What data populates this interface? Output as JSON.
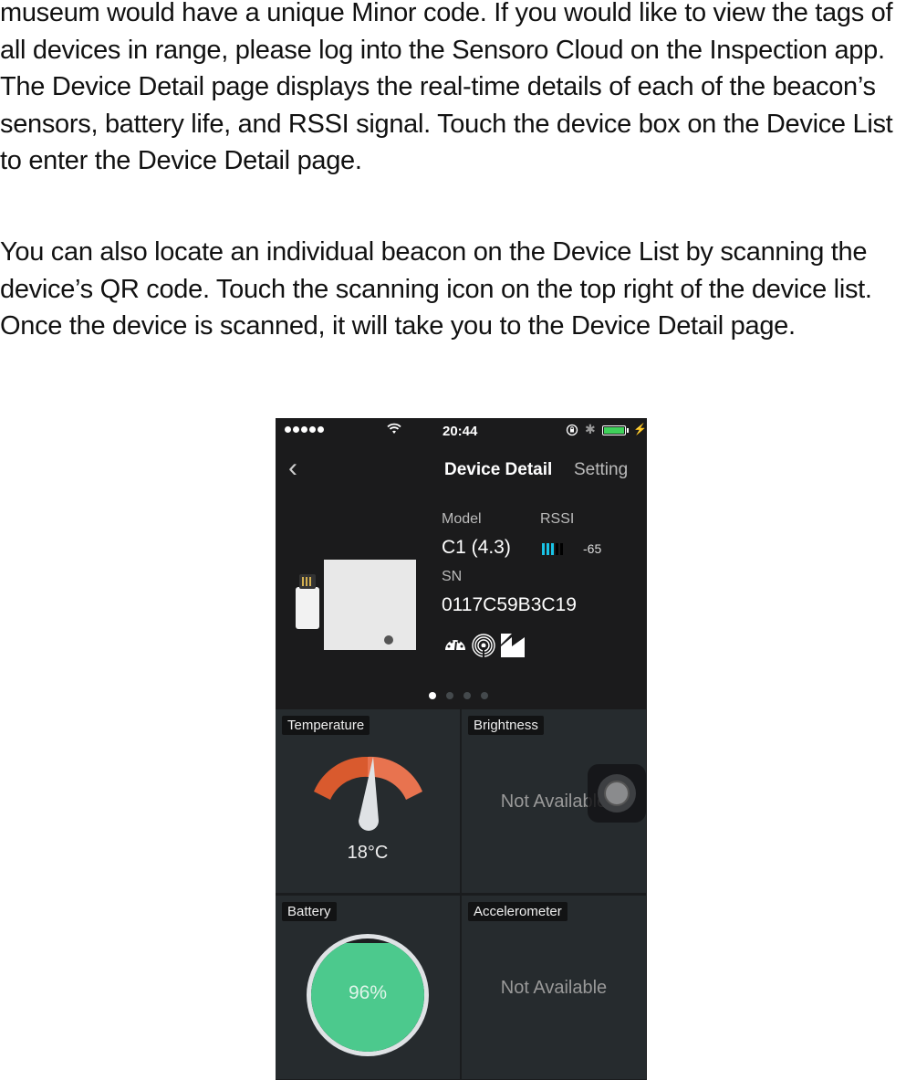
{
  "document": {
    "paragraph1": "museum would have a unique Minor code. If you would like to view the tags of all devices in range, please log into the Sensoro Cloud on the Inspection app.",
    "paragraph1b": "The Device Detail page displays the real-time details of each of the beacon’s sensors, battery life, and RSSI signal. Touch the device box on the Device List to enter the Device Detail page.",
    "paragraph2": "You can also locate an individual beacon on the Device List by scanning the device’s QR code. Touch the scanning icon on the top right of the device list. Once the device is scanned, it will take you to the Device Detail page."
  },
  "phone": {
    "status_bar": {
      "time": "20:44",
      "signal_icon": "signal-dots-icon",
      "wifi_icon": "wifi-icon",
      "rotation_lock_icon": "rotation-lock-icon",
      "bluetooth_icon": "bluetooth-icon",
      "battery_icon": "battery-icon",
      "charging_icon": "charging-bolt-icon",
      "bluetooth_glyph": "✱",
      "bolt_glyph": "⚡"
    },
    "nav": {
      "back_glyph": "‹",
      "title": "Device Detail",
      "setting": "Setting"
    },
    "device": {
      "model_label": "Model",
      "model_value": "C1 (4.3)",
      "rssi_label": "RSSI",
      "rssi_value": "-65",
      "rssi_bars_active": 3,
      "rssi_bars_total": 5,
      "rssi_color": "#19c3e6",
      "sn_label": "SN",
      "sn_value": "0117C59B3C19",
      "feature_icons": [
        "gauge-icon",
        "radar-signal-icon",
        "accelerometer-icon"
      ]
    },
    "pager": {
      "pages": 4,
      "active": 0
    },
    "sensors": {
      "temperature": {
        "label": "Temperature",
        "value": "18°C",
        "gauge_colors": [
          "#d95a2e",
          "#e8734f"
        ]
      },
      "brightness": {
        "label": "Brightness",
        "value": "Not Available"
      },
      "battery": {
        "label": "Battery",
        "value": "96%",
        "percent": 96,
        "color": "#4cc98d"
      },
      "accelerometer": {
        "label": "Accelerometer",
        "value": "Not Available"
      }
    }
  }
}
